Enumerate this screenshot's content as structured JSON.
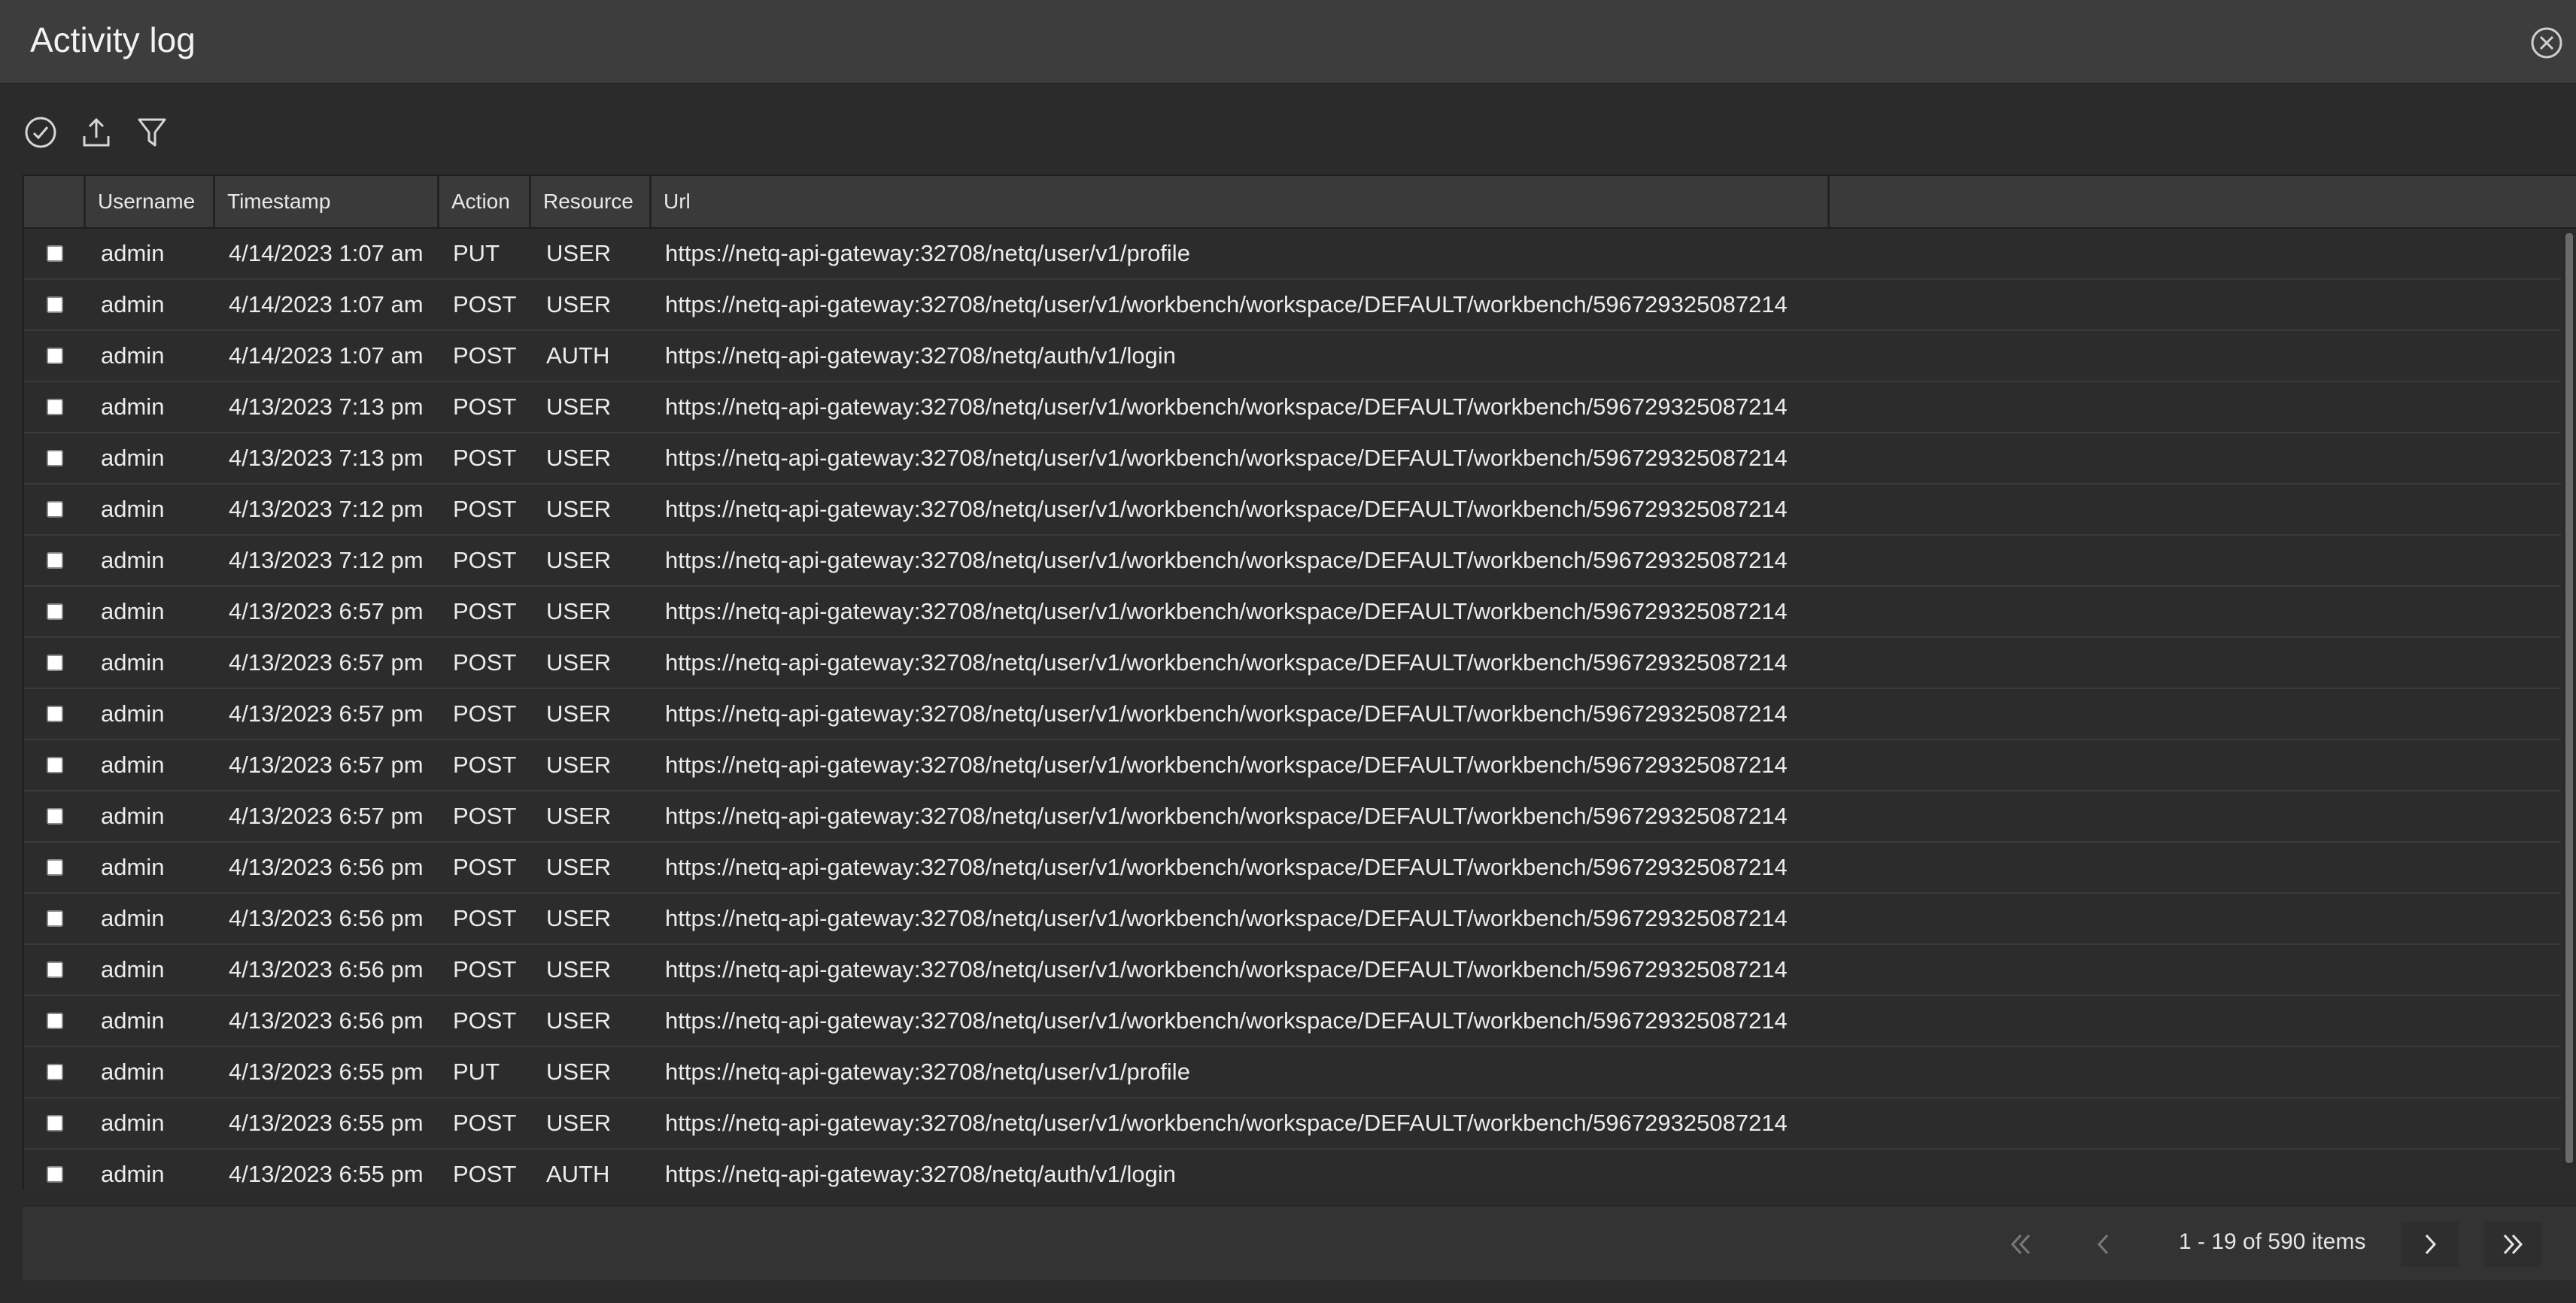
{
  "window": {
    "title": "Activity log"
  },
  "icons": {
    "close": "close-circle-icon",
    "select_all": "check-circle-icon",
    "export": "upload-icon",
    "filter": "filter-icon",
    "first": "double-chevron-left-icon",
    "prev": "chevron-left-icon",
    "next": "chevron-right-icon",
    "last": "double-chevron-right-icon"
  },
  "colors": {
    "background": "#2b2b2b",
    "titlebar": "#3d3d3d",
    "header": "#3a3a3a",
    "text": "#e6e6e6"
  },
  "table": {
    "columns": [
      "Username",
      "Timestamp",
      "Action",
      "Resource",
      "Url"
    ],
    "rows": [
      {
        "username": "admin",
        "timestamp": "4/14/2023 1:07 am",
        "action": "PUT",
        "resource": "USER",
        "url": "https://netq-api-gateway:32708/netq/user/v1/profile"
      },
      {
        "username": "admin",
        "timestamp": "4/14/2023 1:07 am",
        "action": "POST",
        "resource": "USER",
        "url": "https://netq-api-gateway:32708/netq/user/v1/workbench/workspace/DEFAULT/workbench/596729325087214"
      },
      {
        "username": "admin",
        "timestamp": "4/14/2023 1:07 am",
        "action": "POST",
        "resource": "AUTH",
        "url": "https://netq-api-gateway:32708/netq/auth/v1/login"
      },
      {
        "username": "admin",
        "timestamp": "4/13/2023 7:13 pm",
        "action": "POST",
        "resource": "USER",
        "url": "https://netq-api-gateway:32708/netq/user/v1/workbench/workspace/DEFAULT/workbench/596729325087214"
      },
      {
        "username": "admin",
        "timestamp": "4/13/2023 7:13 pm",
        "action": "POST",
        "resource": "USER",
        "url": "https://netq-api-gateway:32708/netq/user/v1/workbench/workspace/DEFAULT/workbench/596729325087214"
      },
      {
        "username": "admin",
        "timestamp": "4/13/2023 7:12 pm",
        "action": "POST",
        "resource": "USER",
        "url": "https://netq-api-gateway:32708/netq/user/v1/workbench/workspace/DEFAULT/workbench/596729325087214"
      },
      {
        "username": "admin",
        "timestamp": "4/13/2023 7:12 pm",
        "action": "POST",
        "resource": "USER",
        "url": "https://netq-api-gateway:32708/netq/user/v1/workbench/workspace/DEFAULT/workbench/596729325087214"
      },
      {
        "username": "admin",
        "timestamp": "4/13/2023 6:57 pm",
        "action": "POST",
        "resource": "USER",
        "url": "https://netq-api-gateway:32708/netq/user/v1/workbench/workspace/DEFAULT/workbench/596729325087214"
      },
      {
        "username": "admin",
        "timestamp": "4/13/2023 6:57 pm",
        "action": "POST",
        "resource": "USER",
        "url": "https://netq-api-gateway:32708/netq/user/v1/workbench/workspace/DEFAULT/workbench/596729325087214"
      },
      {
        "username": "admin",
        "timestamp": "4/13/2023 6:57 pm",
        "action": "POST",
        "resource": "USER",
        "url": "https://netq-api-gateway:32708/netq/user/v1/workbench/workspace/DEFAULT/workbench/596729325087214"
      },
      {
        "username": "admin",
        "timestamp": "4/13/2023 6:57 pm",
        "action": "POST",
        "resource": "USER",
        "url": "https://netq-api-gateway:32708/netq/user/v1/workbench/workspace/DEFAULT/workbench/596729325087214"
      },
      {
        "username": "admin",
        "timestamp": "4/13/2023 6:57 pm",
        "action": "POST",
        "resource": "USER",
        "url": "https://netq-api-gateway:32708/netq/user/v1/workbench/workspace/DEFAULT/workbench/596729325087214"
      },
      {
        "username": "admin",
        "timestamp": "4/13/2023 6:56 pm",
        "action": "POST",
        "resource": "USER",
        "url": "https://netq-api-gateway:32708/netq/user/v1/workbench/workspace/DEFAULT/workbench/596729325087214"
      },
      {
        "username": "admin",
        "timestamp": "4/13/2023 6:56 pm",
        "action": "POST",
        "resource": "USER",
        "url": "https://netq-api-gateway:32708/netq/user/v1/workbench/workspace/DEFAULT/workbench/596729325087214"
      },
      {
        "username": "admin",
        "timestamp": "4/13/2023 6:56 pm",
        "action": "POST",
        "resource": "USER",
        "url": "https://netq-api-gateway:32708/netq/user/v1/workbench/workspace/DEFAULT/workbench/596729325087214"
      },
      {
        "username": "admin",
        "timestamp": "4/13/2023 6:56 pm",
        "action": "POST",
        "resource": "USER",
        "url": "https://netq-api-gateway:32708/netq/user/v1/workbench/workspace/DEFAULT/workbench/596729325087214"
      },
      {
        "username": "admin",
        "timestamp": "4/13/2023 6:55 pm",
        "action": "PUT",
        "resource": "USER",
        "url": "https://netq-api-gateway:32708/netq/user/v1/profile"
      },
      {
        "username": "admin",
        "timestamp": "4/13/2023 6:55 pm",
        "action": "POST",
        "resource": "USER",
        "url": "https://netq-api-gateway:32708/netq/user/v1/workbench/workspace/DEFAULT/workbench/596729325087214"
      },
      {
        "username": "admin",
        "timestamp": "4/13/2023 6:55 pm",
        "action": "POST",
        "resource": "AUTH",
        "url": "https://netq-api-gateway:32708/netq/auth/v1/login"
      }
    ]
  },
  "pagination": {
    "info": "1 - 19 of 590 items"
  }
}
